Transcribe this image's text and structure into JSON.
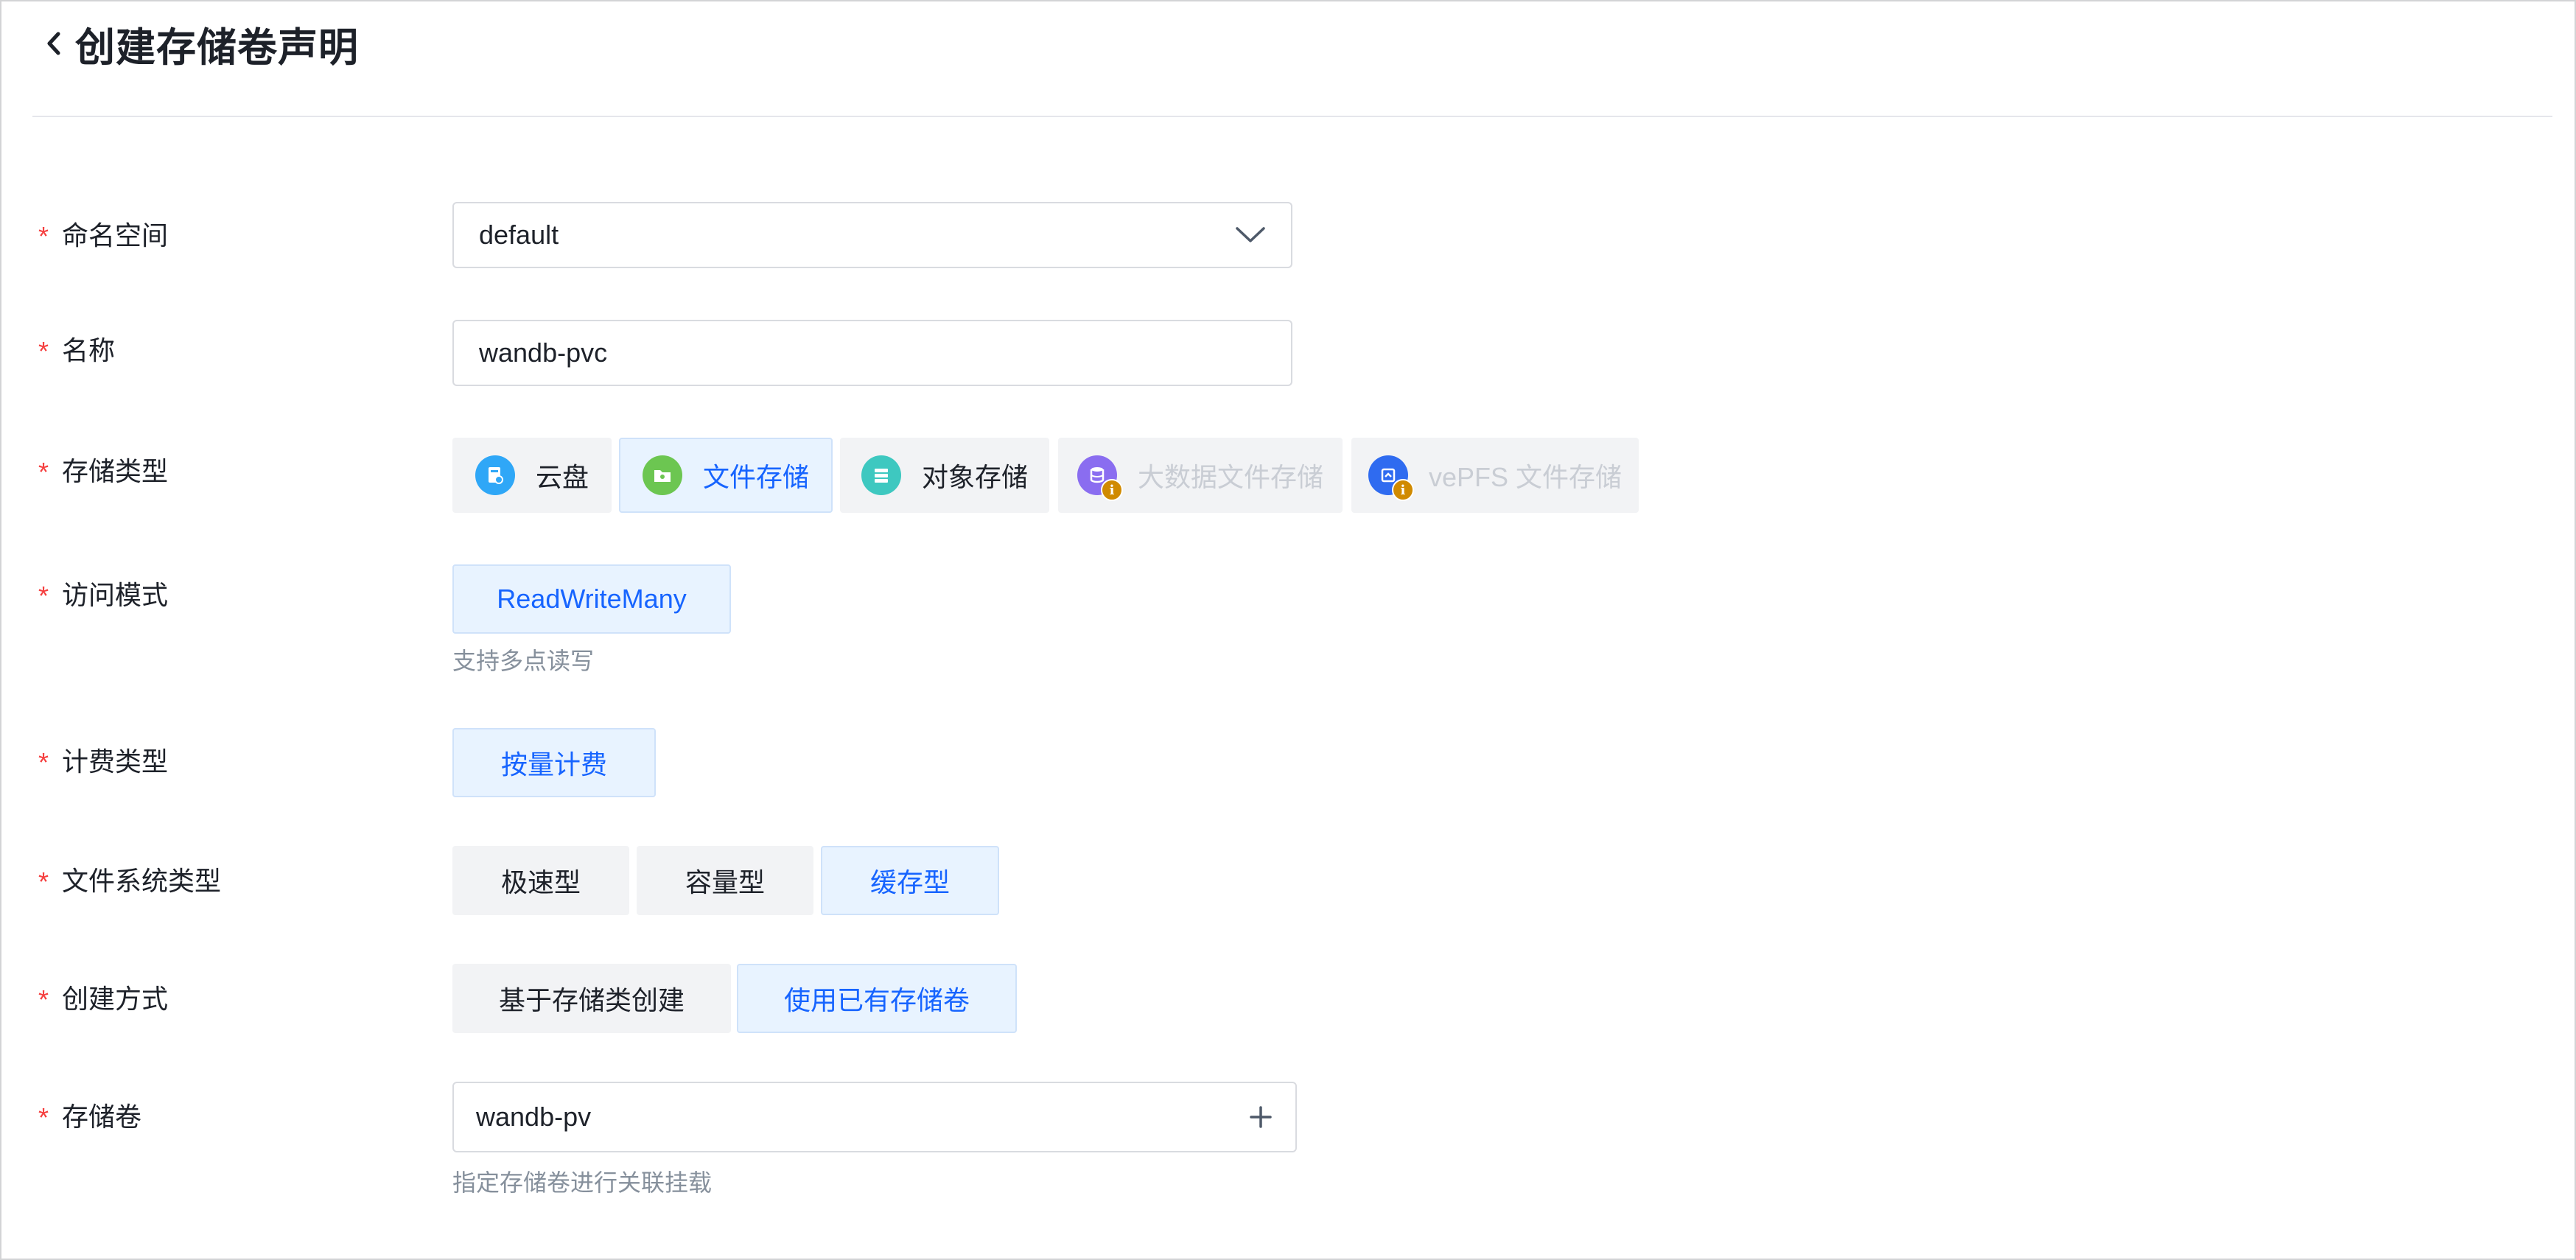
{
  "page": {
    "title": "创建存储卷声明"
  },
  "form": {
    "namespace": {
      "label": "命名空间",
      "value": "default"
    },
    "name": {
      "label": "名称",
      "value": "wandb-pvc"
    },
    "storage_type": {
      "label": "存储类型",
      "options": [
        {
          "label": "云盘",
          "icon": "cloud-disk-icon",
          "color": "#2fa7f7",
          "state": "normal"
        },
        {
          "label": "文件存储",
          "icon": "file-storage-icon",
          "color": "#6cc651",
          "state": "selected"
        },
        {
          "label": "对象存储",
          "icon": "object-storage-icon",
          "color": "#3ec8c0",
          "state": "normal"
        },
        {
          "label": "大数据文件存储",
          "icon": "bigdata-storage-icon",
          "color": "#8a6df0",
          "state": "disabled"
        },
        {
          "label": "vePFS 文件存储",
          "icon": "vepfs-storage-icon",
          "color": "#2f6bf0",
          "state": "disabled"
        }
      ]
    },
    "access_mode": {
      "label": "访问模式",
      "options": [
        {
          "label": "ReadWriteMany",
          "state": "selected"
        }
      ],
      "hint": "支持多点读写"
    },
    "billing_type": {
      "label": "计费类型",
      "options": [
        {
          "label": "按量计费",
          "state": "selected"
        }
      ]
    },
    "fs_type": {
      "label": "文件系统类型",
      "options": [
        {
          "label": "极速型",
          "state": "normal"
        },
        {
          "label": "容量型",
          "state": "normal"
        },
        {
          "label": "缓存型",
          "state": "selected"
        }
      ]
    },
    "create_method": {
      "label": "创建方式",
      "options": [
        {
          "label": "基于存储类创建",
          "state": "normal"
        },
        {
          "label": "使用已有存储卷",
          "state": "selected"
        }
      ]
    },
    "volume": {
      "label": "存储卷",
      "value": "wandb-pv",
      "hint": "指定存储卷进行关联挂载"
    }
  },
  "colors": {
    "primary": "#1664ff",
    "required": "#f53f3f",
    "disabled_text": "#c9cdd4",
    "badge": "#d08a00"
  }
}
